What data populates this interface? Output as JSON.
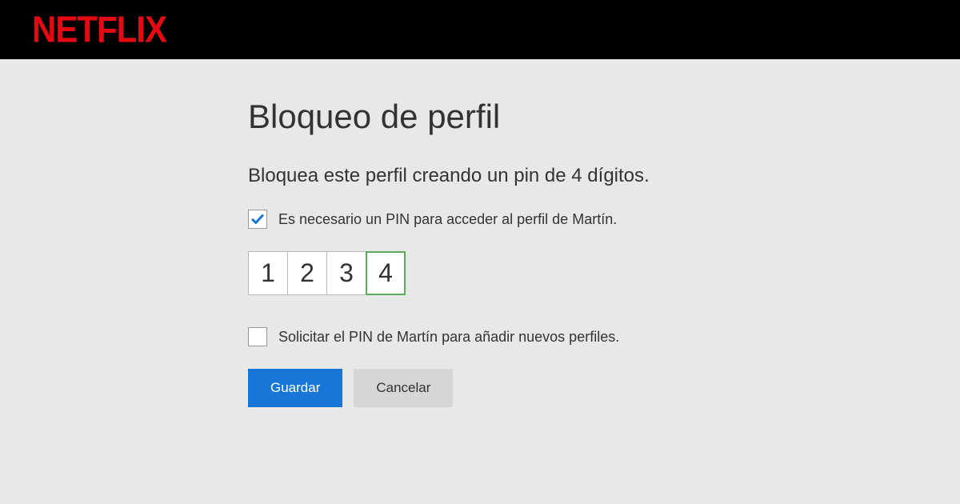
{
  "header": {
    "logo_text": "NETFLIX"
  },
  "page": {
    "title": "Bloqueo de perfil",
    "subtitle": "Bloquea este perfil creando un pin de 4 dígitos."
  },
  "checkbox_require_pin": {
    "checked": true,
    "label": "Es necesario un PIN para acceder al perfil de Martín."
  },
  "pin": {
    "digits": [
      "1",
      "2",
      "3",
      "4"
    ],
    "active_index": 3
  },
  "checkbox_new_profiles": {
    "checked": false,
    "label": "Solicitar el PIN de Martín para añadir nuevos perfiles."
  },
  "buttons": {
    "save": "Guardar",
    "cancel": "Cancelar"
  }
}
